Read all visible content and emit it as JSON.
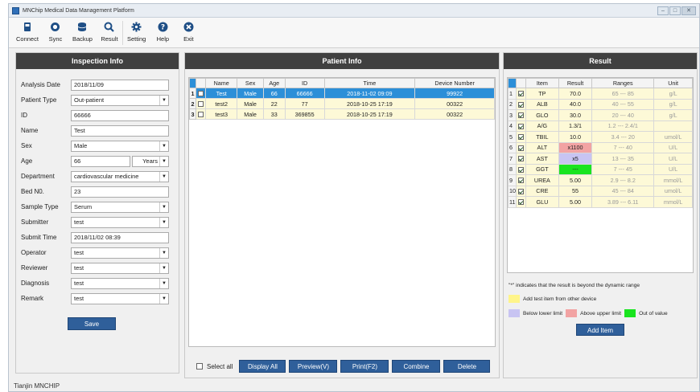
{
  "window": {
    "title": "MNChip Medical Data Management Platform"
  },
  "toolbar": [
    {
      "label": "Connect",
      "icon": "connect-icon"
    },
    {
      "label": "Sync",
      "icon": "sync-icon"
    },
    {
      "label": "Backup",
      "icon": "backup-icon"
    },
    {
      "label": "Result",
      "icon": "search-icon"
    },
    {
      "label": "Setting",
      "icon": "gear-icon"
    },
    {
      "label": "Help",
      "icon": "help-icon"
    },
    {
      "label": "Exit",
      "icon": "exit-icon"
    }
  ],
  "inspection": {
    "header": "Inspection Info",
    "fields": {
      "analysis_date": {
        "label": "Analysis Date",
        "value": "2018/11/09"
      },
      "patient_type": {
        "label": "Patient Type",
        "value": "Out-patient"
      },
      "id": {
        "label": "ID",
        "value": "66666"
      },
      "name": {
        "label": "Name",
        "value": "Test"
      },
      "sex": {
        "label": "Sex",
        "value": "Male"
      },
      "age": {
        "label": "Age",
        "value": "66",
        "unit": "Years"
      },
      "department": {
        "label": "Department",
        "value": "cardiovascular medicine"
      },
      "bed_no": {
        "label": "Bed N0.",
        "value": "23"
      },
      "sample_type": {
        "label": "Sample Type",
        "value": "Serum"
      },
      "submitter": {
        "label": "Submitter",
        "value": "test"
      },
      "submit_time": {
        "label": "Submit Time",
        "value": "2018/11/02 08:39"
      },
      "operator": {
        "label": "Operator",
        "value": "test"
      },
      "reviewer": {
        "label": "Reviewer",
        "value": "test"
      },
      "diagnosis": {
        "label": "Diagnosis",
        "value": "test"
      },
      "remark": {
        "label": "Remark",
        "value": "test"
      }
    },
    "save_label": "Save"
  },
  "patient": {
    "header": "Patient Info",
    "columns": [
      "Name",
      "Sex",
      "Age",
      "ID",
      "Time",
      "Device Number"
    ],
    "rows": [
      {
        "num": "1",
        "name": "Test",
        "sex": "Male",
        "age": "66",
        "id": "66666",
        "time": "2018-11-02 09:09",
        "device": "99922"
      },
      {
        "num": "2",
        "name": "test2",
        "sex": "Male",
        "age": "22",
        "id": "77",
        "time": "2018-10-25 17:19",
        "device": "00322"
      },
      {
        "num": "3",
        "name": "test3",
        "sex": "Male",
        "age": "33",
        "id": "369855",
        "time": "2018-10-25 17:19",
        "device": "00322"
      }
    ],
    "select_all_label": "Select all",
    "actions": [
      "Display All",
      "Preview(V)",
      "Print(F2)",
      "Combine",
      "Delete"
    ]
  },
  "result": {
    "header": "Result",
    "columns": [
      "Item",
      "Result",
      "Ranges",
      "Unit"
    ],
    "rows": [
      {
        "num": "1",
        "item": "TP",
        "result": "70.0",
        "range": "65 --- 85",
        "unit": "g/L",
        "flag": ""
      },
      {
        "num": "2",
        "item": "ALB",
        "result": "40.0",
        "range": "40 --- 55",
        "unit": "g/L",
        "flag": ""
      },
      {
        "num": "3",
        "item": "GLO",
        "result": "30.0",
        "range": "20 --- 40",
        "unit": "g/L",
        "flag": ""
      },
      {
        "num": "4",
        "item": "A/G",
        "result": "1.3/1",
        "range": "1.2 --- 2.4/1",
        "unit": "",
        "flag": ""
      },
      {
        "num": "5",
        "item": "TBIL",
        "result": "10.0",
        "range": "3.4 --- 20",
        "unit": "umol/L",
        "flag": ""
      },
      {
        "num": "6",
        "item": "ALT",
        "result": "x1100",
        "range": "7 --- 40",
        "unit": "U/L",
        "flag": "above"
      },
      {
        "num": "7",
        "item": "AST",
        "result": "x5",
        "range": "13 --- 35",
        "unit": "U/L",
        "flag": "below"
      },
      {
        "num": "8",
        "item": "GGT",
        "result": "---",
        "range": "7 --- 45",
        "unit": "U/L",
        "flag": "out"
      },
      {
        "num": "9",
        "item": "UREA",
        "result": "5.00",
        "range": "2.9 --- 8.2",
        "unit": "mmol/L",
        "flag": ""
      },
      {
        "num": "10",
        "item": "CRE",
        "result": "55",
        "range": "45 --- 84",
        "unit": "umol/L",
        "flag": ""
      },
      {
        "num": "11",
        "item": "GLU",
        "result": "5.00",
        "range": "3.89 --- 6.11",
        "unit": "mmol/L",
        "flag": ""
      }
    ],
    "note": "\"*\" indicates that the result is beyond the dynamic range",
    "legend": {
      "other_device": "Add test item from other device",
      "below": "Below lower limit",
      "above": "Above upper limit",
      "out": "Out of value"
    },
    "add_item_label": "Add Item"
  },
  "colors": {
    "panel_header": "#404040",
    "button": "#2f5f9a",
    "selected_row": "#2c8fd8",
    "row_pale": "#fdf9d7",
    "other_device": "#fff58a",
    "below": "#c8c4f2",
    "above": "#f2a3a3",
    "out": "#19e41f"
  },
  "footer": {
    "text": "Tianjin MNCHIP"
  }
}
